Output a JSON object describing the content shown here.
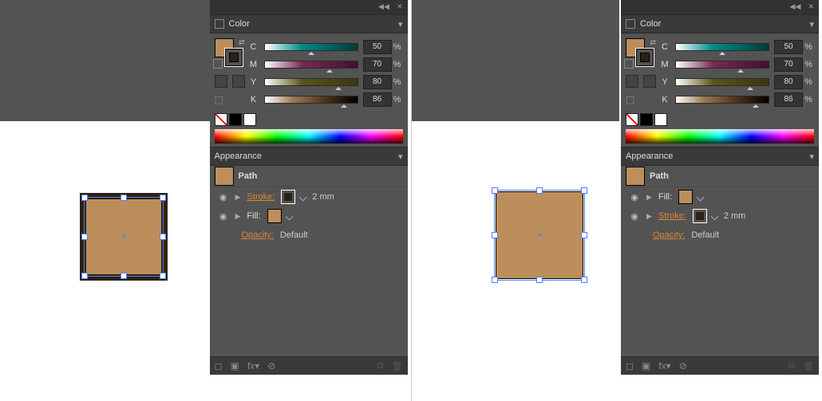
{
  "panels": {
    "color": "Color",
    "appearance": "Appearance"
  },
  "cmyk": {
    "channels": [
      "C",
      "M",
      "Y",
      "K"
    ],
    "values": {
      "C": 50,
      "M": 70,
      "Y": 80,
      "K": 86
    },
    "pct": "%"
  },
  "appearance": {
    "path": "Path",
    "stroke": "Stroke:",
    "fill": "Fill:",
    "strokeVal": "2 mm",
    "opacity": "Opacity:",
    "opVal": "Default",
    "fx": "fx"
  },
  "icons": {
    "menu": "▾",
    "eye": "◉",
    "tri": "▶",
    "close": "✕",
    "collapse": "◀◀"
  }
}
